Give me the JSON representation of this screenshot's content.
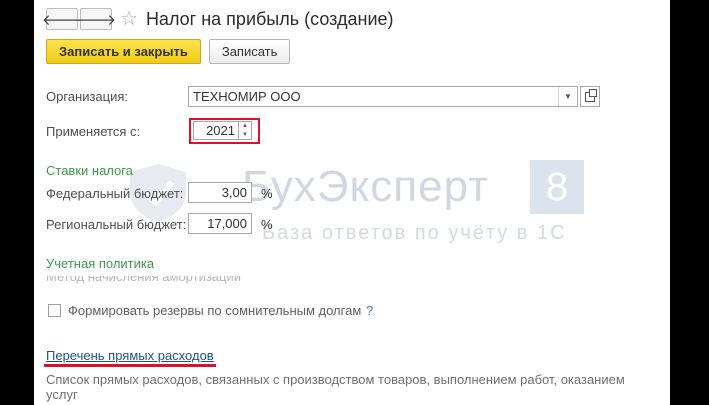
{
  "window": {
    "title": "Налог на прибыль (создание)"
  },
  "toolbar": {
    "back_glyph": "🡐",
    "forward_glyph": "🡒",
    "star_glyph": "☆"
  },
  "actions": {
    "save_close": "Записать и закрыть",
    "save": "Записать"
  },
  "fields": {
    "organization_label": "Организация:",
    "organization_value": "ТЕХНОМИР ООО",
    "applies_from_label": "Применяется с:",
    "applies_from_year": "2021"
  },
  "tax_rates": {
    "section_title": "Ставки налога",
    "federal_label": "Федеральный бюджет:",
    "federal_value": "3,00",
    "regional_label": "Региональный бюджет:",
    "regional_value": "17,000",
    "percent": "%"
  },
  "accounting_policy": {
    "section_title": "Учетная политика",
    "cut_text": "Метод начисления амортизации",
    "reserves_label": "Формировать резервы по сомнительным долгам",
    "help_glyph": "?"
  },
  "direct_costs": {
    "link": "Перечень прямых расходов",
    "description": "Список прямых расходов, связанных с производством товаров, выполнением работ, оказанием услуг"
  },
  "watermark": {
    "brand": "БухЭксперт",
    "badge": "8",
    "tagline": "База ответов по учёту в 1С"
  },
  "colors": {
    "primary_button": "#f2cc13",
    "section_green": "#3a9a49",
    "highlight_red": "#d7132c",
    "link_blue": "#1a4f99"
  }
}
